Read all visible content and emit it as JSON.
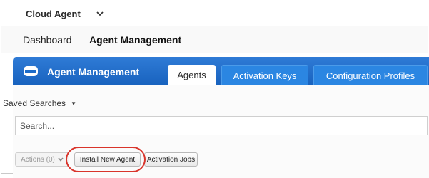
{
  "appbar": {
    "module_label": "Cloud Agent",
    "module_icon": "chevron-down-icon"
  },
  "subnav": {
    "dashboard": "Dashboard",
    "agent_management": "Agent Management"
  },
  "panel": {
    "title": "Agent Management",
    "title_icon": "cloud-agent-icon",
    "header_color": "#1d6cc9",
    "tabs": [
      {
        "label": "Agents",
        "active": true
      },
      {
        "label": "Activation Keys",
        "active": false
      },
      {
        "label": "Configuration Profiles",
        "active": false
      }
    ]
  },
  "search": {
    "saved_searches_label": "Saved Searches",
    "placeholder": "Search..."
  },
  "toolbar": {
    "actions_label": "Actions (0)",
    "install_label": "Install New Agent",
    "jobs_label": "Activation Jobs",
    "highlight_color": "#d9342b"
  }
}
